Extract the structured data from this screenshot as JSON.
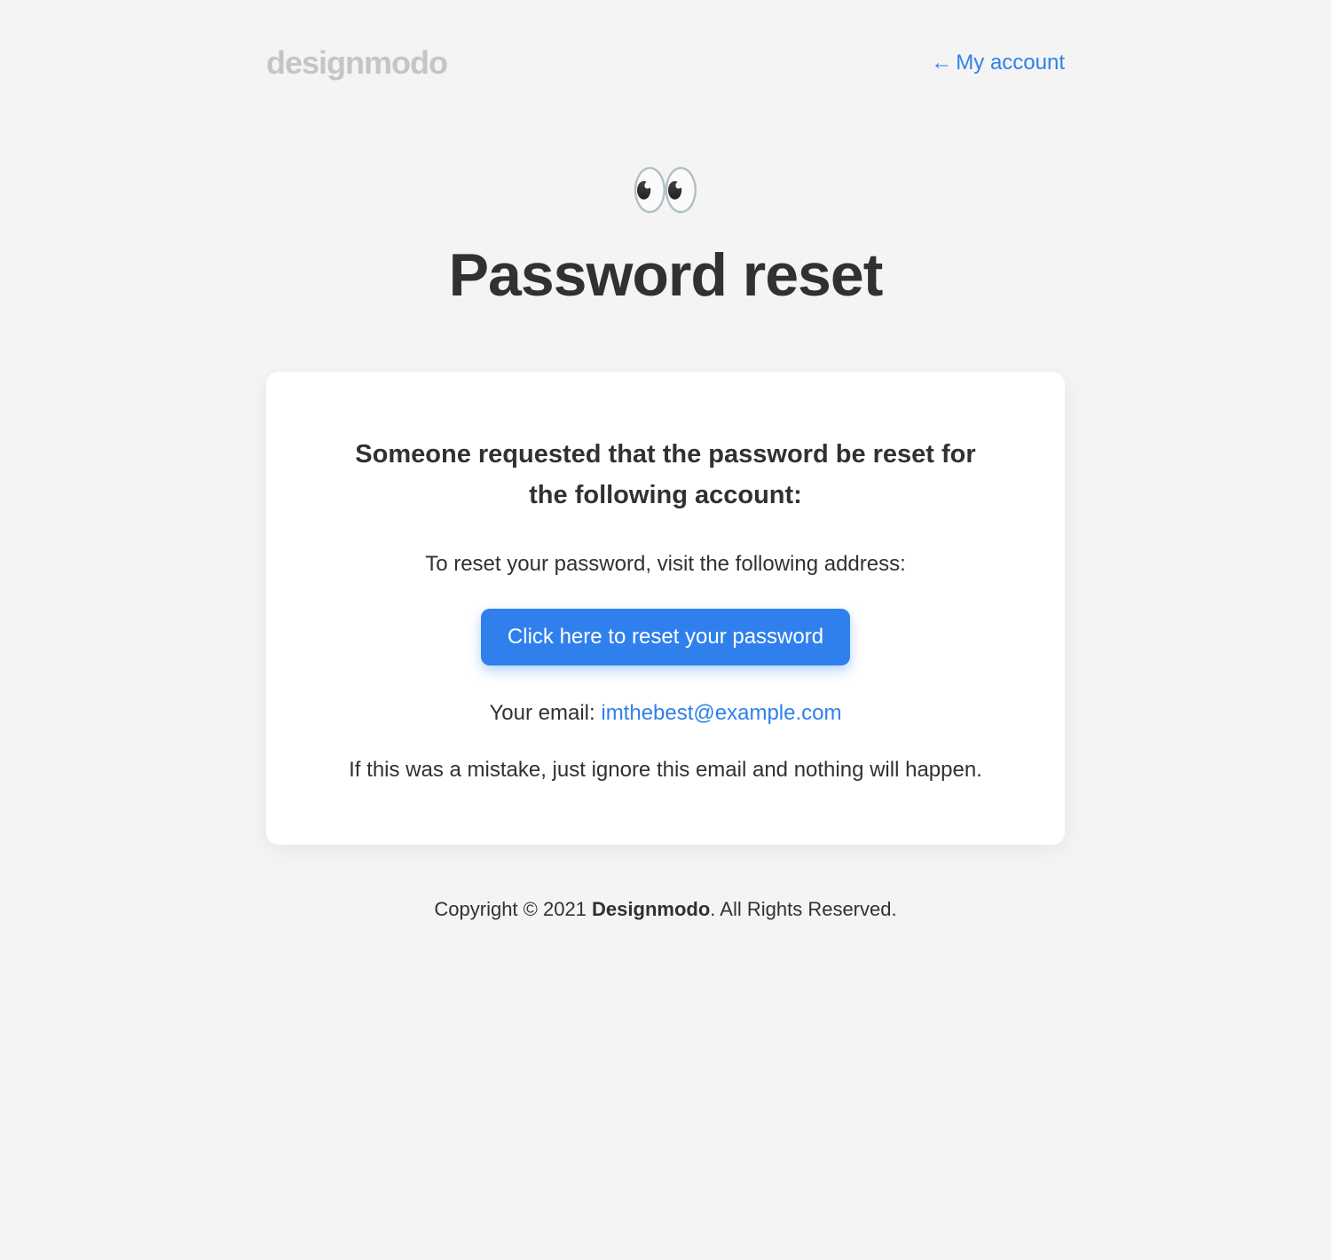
{
  "header": {
    "logo_text": "designmodo",
    "account_link_arrow": "←",
    "account_link_label": "My account"
  },
  "hero": {
    "emoji": "👀",
    "title": "Password reset"
  },
  "card": {
    "lead": "Someone requested that the password be reset for the following account:",
    "instruction": "To reset your password, visit the following address:",
    "cta_label": "Click here to reset your password",
    "email_prefix": "Your email: ",
    "email_address": "imthebest@example.com",
    "disclaimer": "If this was a mistake, just ignore this email and nothing will happen."
  },
  "footer": {
    "copyright_prefix": "Copyright © 2021 ",
    "brand": "Designmodo",
    "copyright_suffix": ". All Rights Reserved."
  }
}
